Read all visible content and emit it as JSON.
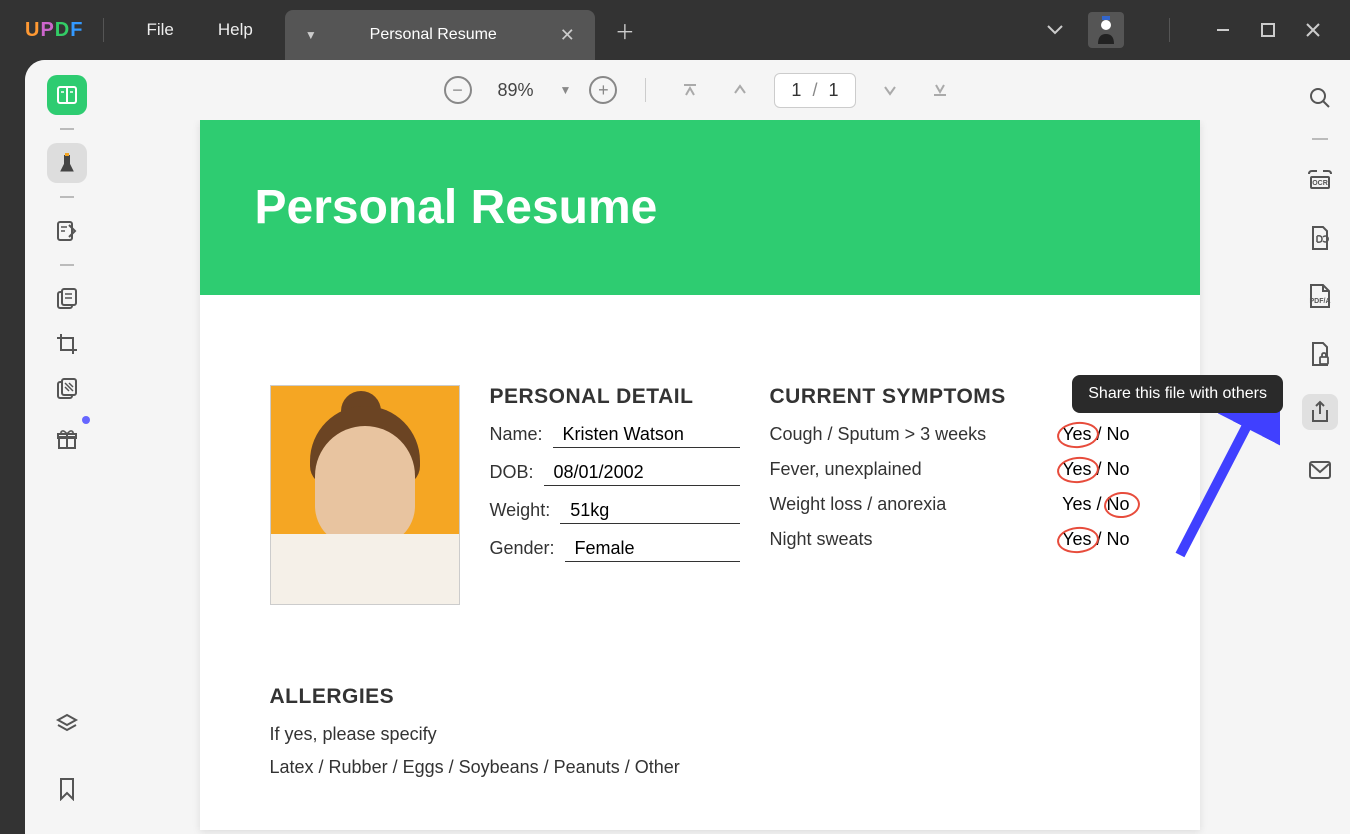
{
  "menu": {
    "file": "File",
    "help": "Help"
  },
  "tab": {
    "title": "Personal Resume"
  },
  "toolbar": {
    "zoom": "89%",
    "page_current": "1",
    "page_sep": "/",
    "page_total": "1"
  },
  "tooltip": {
    "share": "Share this file with others"
  },
  "document": {
    "title": "Personal Resume",
    "detail_heading": "PERSONAL DETAIL",
    "details": {
      "name_label": "Name:",
      "name_value": "Kristen Watson",
      "dob_label": "DOB:",
      "dob_value": "08/01/2002",
      "weight_label": "Weight:",
      "weight_value": "51kg",
      "gender_label": "Gender:",
      "gender_value": "Female"
    },
    "symptoms_heading": "CURRENT SYMPTOMS",
    "symptoms": [
      {
        "label": "Cough / Sputum > 3 weeks",
        "yn": "Yes / No",
        "circled": "yes"
      },
      {
        "label": "Fever, unexplained",
        "yn": "Yes / No",
        "circled": "yes"
      },
      {
        "label": "Weight loss / anorexia",
        "yn": "Yes / No",
        "circled": "no"
      },
      {
        "label": "Night sweats",
        "yn": "Yes / No",
        "circled": "yes"
      }
    ],
    "allergies_heading": "ALLERGIES",
    "allergies_line1": "If yes, please specify",
    "allergies_line2": "Latex / Rubber / Eggs / Soybeans / Peanuts / Other"
  }
}
